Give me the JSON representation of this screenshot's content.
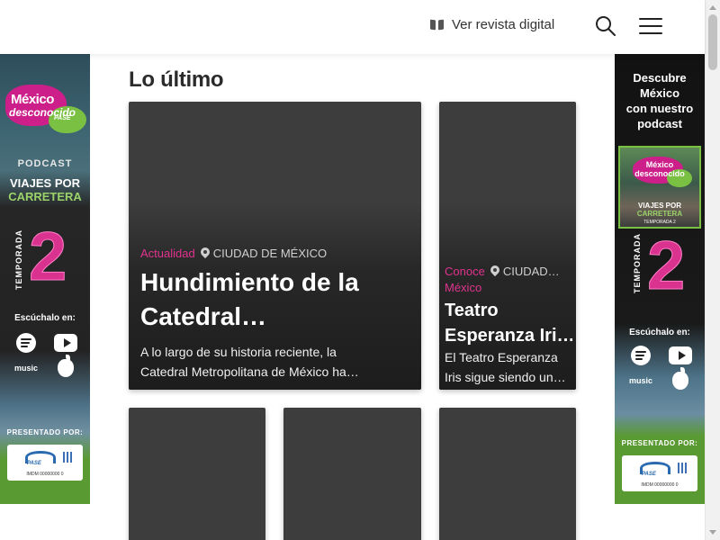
{
  "header": {
    "magazine_link": "Ver revista digital",
    "book_icon": "book-open-icon",
    "search_icon": "search-icon",
    "menu_icon": "hamburger-menu-icon"
  },
  "section": {
    "title": "Lo último"
  },
  "featured_cards": [
    {
      "category": "Actualidad",
      "location": "CIUDAD DE MÉXICO",
      "title_lines": [
        "Hundimiento de la",
        "Catedral…"
      ],
      "excerpt_lines": [
        "A lo largo de su historia reciente, la",
        "Catedral Metropolitana de México ha…"
      ]
    },
    {
      "category_lines": [
        "Conoce",
        "México"
      ],
      "location": "CIUDAD…",
      "title_lines": [
        "Teatro",
        "Esperanza Iri…"
      ],
      "excerpt_lines": [
        "El Teatro Esperanza",
        "Iris sigue siendo un…"
      ]
    }
  ],
  "ad_left": {
    "logo_lines": [
      "México",
      "desconocido",
      "PASE"
    ],
    "podcast_label": "PODCAST",
    "route_lines": [
      "VIAJES POR",
      "CARRETERA"
    ],
    "season_word": "TEMPORADA",
    "season_number": "2",
    "listen_label": "Escúchalo en:",
    "music_label": "music",
    "presented_label": "PRESENTADO POR:",
    "sponsor_brand": "PASE",
    "sponsor_code": "IMDM 00000000 0"
  },
  "ad_right": {
    "promo_lines": [
      "Descubre",
      "México",
      "con nuestro",
      "podcast"
    ],
    "cover_title": "México desconocido",
    "cover_route_lines": [
      "VIAJES POR",
      "CARRETERA"
    ],
    "cover_season": "TEMPORADA 2",
    "season_word": "TEMPORADA",
    "season_number": "2",
    "listen_label": "Escúchalo en:",
    "music_label": "music",
    "presented_label": "PRESENTADO POR:",
    "sponsor_brand": "PASE",
    "sponsor_code": "IMDM 00000000 0"
  },
  "colors": {
    "accent_pink": "#e0338e",
    "card_bg": "#3d3d3d",
    "brand_green": "#7ac143"
  }
}
